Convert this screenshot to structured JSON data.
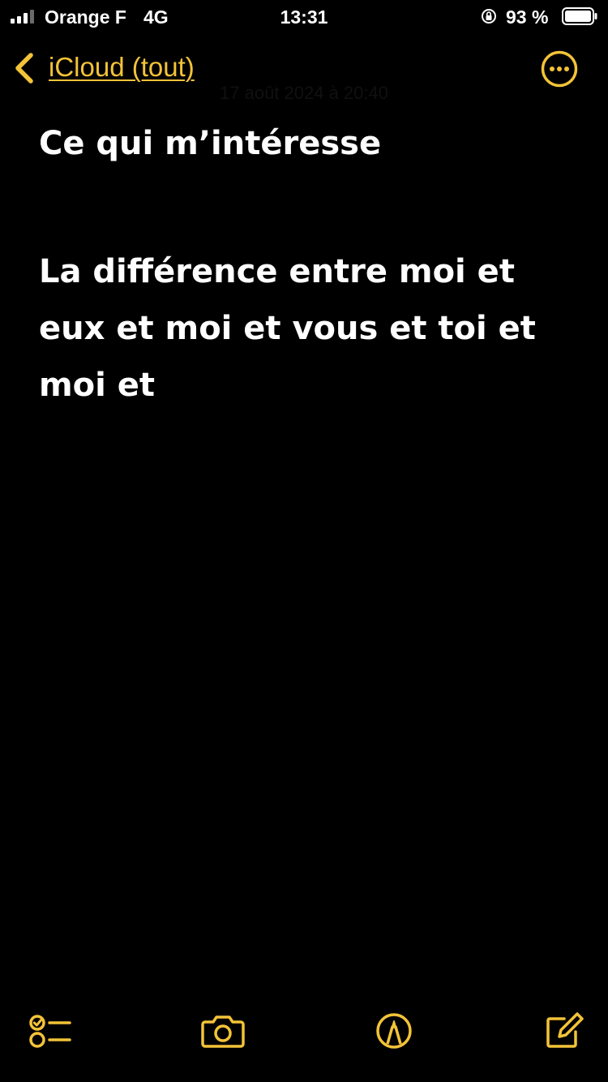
{
  "status_bar": {
    "carrier": "Orange F",
    "network": "4G",
    "time": "13:31",
    "battery_percent": "93 %"
  },
  "nav": {
    "back_label": "iCloud (tout)",
    "back_icon": "chevron-left-icon",
    "more_icon": "ellipsis-circle-icon",
    "ghost_date": "17 août 2024 à 20:40"
  },
  "note": {
    "title": "Ce qui m’intéresse",
    "body_lines": [
      "La différence entre moi et",
      "eux et moi et vous et toi et",
      "moi et"
    ]
  },
  "toolbar": {
    "items": [
      {
        "icon": "checklist-icon"
      },
      {
        "icon": "camera-icon"
      },
      {
        "icon": "markup-pen-icon"
      },
      {
        "icon": "compose-icon"
      }
    ]
  },
  "colors": {
    "accent": "#f3c338",
    "background": "#000000",
    "text": "#ffffff"
  }
}
